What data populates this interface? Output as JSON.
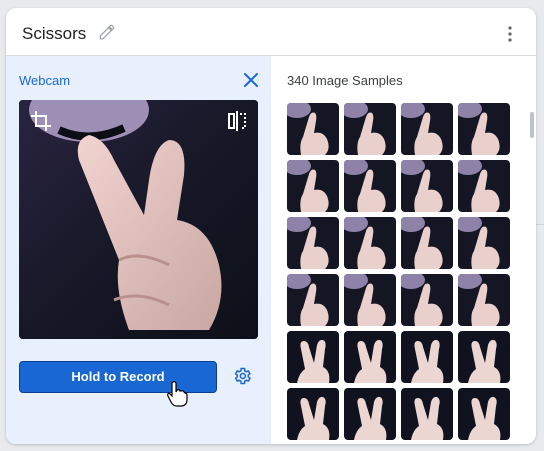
{
  "card": {
    "title": "Scissors",
    "edit_icon": "pencil-icon",
    "menu_icon": "more-vert-icon"
  },
  "webcam": {
    "label": "Webcam",
    "close_icon": "close-icon",
    "crop_icon": "crop-icon",
    "flip_icon": "flip-icon",
    "record_button": "Hold to Record",
    "settings_icon": "gear-icon"
  },
  "samples": {
    "heading": "340 Image Samples",
    "visible_rows": [
      [
        "single",
        "single",
        "single",
        "single"
      ],
      [
        "single",
        "single",
        "single",
        "single"
      ],
      [
        "single",
        "single",
        "single",
        "single"
      ],
      [
        "single",
        "single",
        "single",
        "single"
      ],
      [
        "v",
        "v",
        "v",
        "v"
      ],
      [
        "v",
        "v",
        "v",
        "v"
      ]
    ]
  },
  "colors": {
    "accent": "#1967d2",
    "panel": "#e8f0fe"
  }
}
